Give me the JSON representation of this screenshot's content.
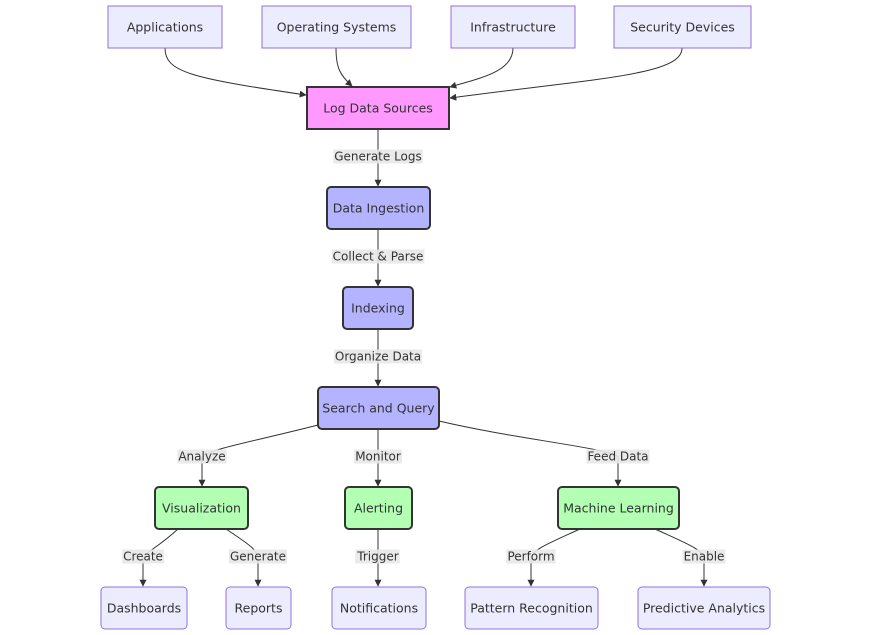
{
  "diagram": {
    "type": "flowchart",
    "colors": {
      "source": "#ececff",
      "source_border": "#9370db",
      "highlight": "#ff99ff",
      "process": "#b3b3ff",
      "output": "#b3ffb3",
      "border_dark": "#333333",
      "edge": "#333333",
      "edge_label_bg": "#e8e8e8"
    },
    "nodes": [
      {
        "id": "apps",
        "label": "Applications",
        "style": "source"
      },
      {
        "id": "os",
        "label": "Operating Systems",
        "style": "source"
      },
      {
        "id": "infra",
        "label": "Infrastructure",
        "style": "source"
      },
      {
        "id": "sec",
        "label": "Security Devices",
        "style": "source"
      },
      {
        "id": "logs",
        "label": "Log Data Sources",
        "style": "highlight"
      },
      {
        "id": "ingest",
        "label": "Data Ingestion",
        "style": "process"
      },
      {
        "id": "index",
        "label": "Indexing",
        "style": "process"
      },
      {
        "id": "search",
        "label": "Search and Query",
        "style": "process"
      },
      {
        "id": "viz",
        "label": "Visualization",
        "style": "output"
      },
      {
        "id": "alert",
        "label": "Alerting",
        "style": "output"
      },
      {
        "id": "ml",
        "label": "Machine Learning",
        "style": "output"
      },
      {
        "id": "dash",
        "label": "Dashboards",
        "style": "source"
      },
      {
        "id": "reports",
        "label": "Reports",
        "style": "source"
      },
      {
        "id": "notif",
        "label": "Notifications",
        "style": "source"
      },
      {
        "id": "pattern",
        "label": "Pattern Recognition",
        "style": "source"
      },
      {
        "id": "predict",
        "label": "Predictive Analytics",
        "style": "source"
      }
    ],
    "edges": [
      {
        "from": "apps",
        "to": "logs",
        "label": ""
      },
      {
        "from": "os",
        "to": "logs",
        "label": ""
      },
      {
        "from": "infra",
        "to": "logs",
        "label": ""
      },
      {
        "from": "sec",
        "to": "logs",
        "label": ""
      },
      {
        "from": "logs",
        "to": "ingest",
        "label": "Generate Logs"
      },
      {
        "from": "ingest",
        "to": "index",
        "label": "Collect & Parse"
      },
      {
        "from": "index",
        "to": "search",
        "label": "Organize Data"
      },
      {
        "from": "search",
        "to": "viz",
        "label": "Analyze"
      },
      {
        "from": "search",
        "to": "alert",
        "label": "Monitor"
      },
      {
        "from": "search",
        "to": "ml",
        "label": "Feed Data"
      },
      {
        "from": "viz",
        "to": "dash",
        "label": "Create"
      },
      {
        "from": "viz",
        "to": "reports",
        "label": "Generate"
      },
      {
        "from": "alert",
        "to": "notif",
        "label": "Trigger"
      },
      {
        "from": "ml",
        "to": "pattern",
        "label": "Perform"
      },
      {
        "from": "ml",
        "to": "predict",
        "label": "Enable"
      }
    ]
  }
}
